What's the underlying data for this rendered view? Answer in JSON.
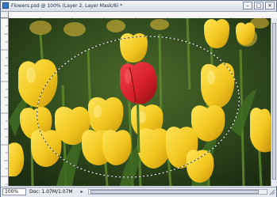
{
  "window": {
    "title": "Flowers.psd @ 100% (Layer 2, Layer Mask/8) *",
    "minimize_label": "–",
    "maximize_label": "□",
    "close_label": "×"
  },
  "status": {
    "zoom": "100%",
    "doc_info": "Doc: 1.07M/1.07M",
    "arrow_label": "▸"
  },
  "colors": {
    "tulip_yellow": "#f2c81e",
    "tulip_red": "#d8202a",
    "foliage_dark": "#27401a"
  },
  "icons": {
    "doc": "document-icon",
    "selection": "marching-ants-selection"
  }
}
